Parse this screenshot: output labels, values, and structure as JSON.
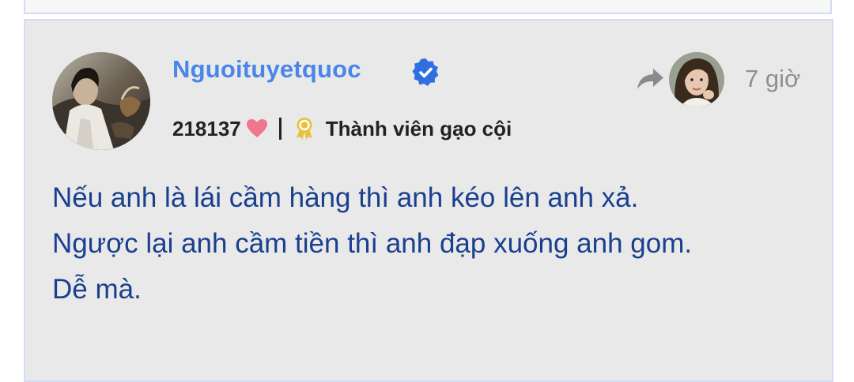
{
  "post": {
    "author": {
      "username": "Nguoituyetquoc",
      "verified": true,
      "reputation": "218137",
      "rank": "Thành viên gạo cội"
    },
    "time": "7 giờ",
    "content_lines": [
      "Nếu anh là lái cầm hàng thì anh kéo lên anh xả.",
      "Ngược lại anh cầm tiền thì anh đạp xuống anh gom.",
      "Dễ mà."
    ]
  },
  "icons": {
    "verified": "verified-check-icon",
    "heart": "heart-icon",
    "rank_badge": "award-ribbon-icon",
    "share": "share-arrow-icon"
  },
  "colors": {
    "username": "#4a86e8",
    "content_text": "#1a3f8f",
    "heart": "#f0758f",
    "badge": "#e8c23a",
    "card_bg": "#e9e9e9",
    "card_border": "#d2dcf3"
  }
}
